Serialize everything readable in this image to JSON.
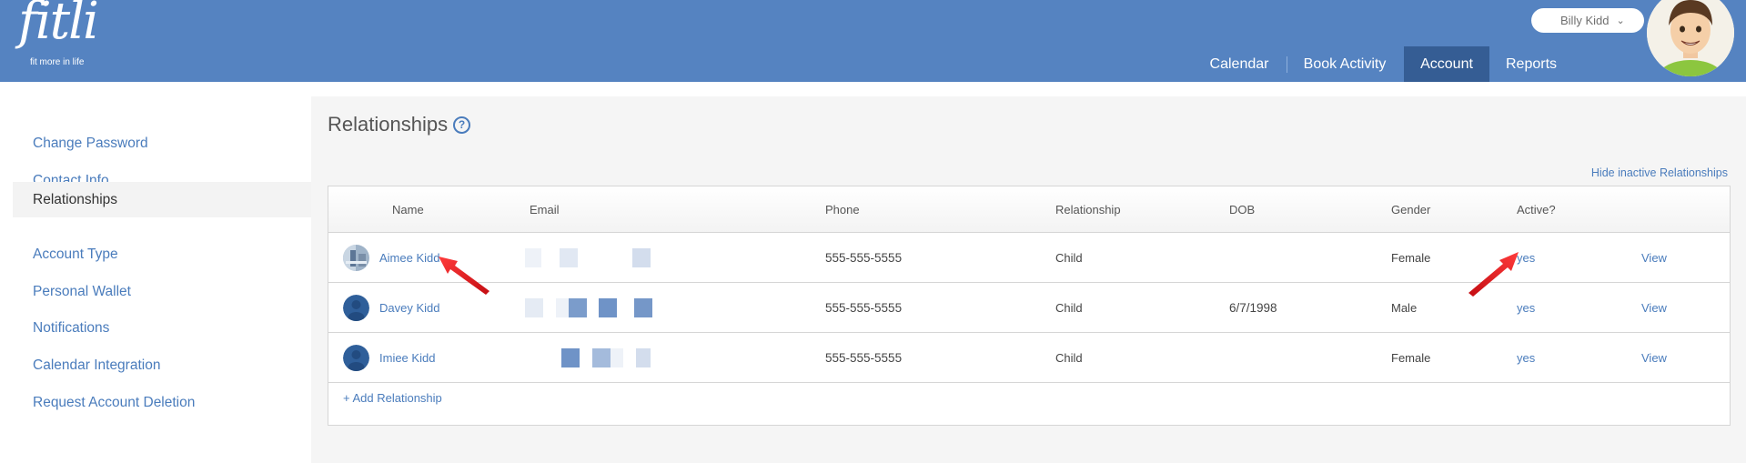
{
  "brand": {
    "logo_text": "fitli",
    "tagline": "fit more in life"
  },
  "user_menu": {
    "name": "Billy Kidd",
    "chevron": "⌄"
  },
  "nav": {
    "items": [
      {
        "label": "Calendar"
      },
      {
        "label": "Book Activity"
      },
      {
        "label": "Account",
        "active": true
      },
      {
        "label": "Reports"
      }
    ]
  },
  "sidebar": {
    "items": [
      {
        "label": "Change Password"
      },
      {
        "label": "Contact Info"
      },
      {
        "label": "Relationships",
        "active": true
      },
      {
        "label": "Account Type"
      },
      {
        "label": "Personal Wallet"
      },
      {
        "label": "Notifications"
      },
      {
        "label": "Calendar Integration"
      },
      {
        "label": "Request Account Deletion"
      }
    ]
  },
  "page": {
    "title": "Relationships",
    "help_icon": "?",
    "hide_inactive_label": "Hide inactive Relationships",
    "add_label": "+ Add Relationship"
  },
  "table": {
    "columns": [
      "Name",
      "Email",
      "Phone",
      "Relationship",
      "DOB",
      "Gender",
      "Active?",
      ""
    ],
    "rows": [
      {
        "name": "Aimee Kidd",
        "email": "",
        "phone": "555-555-5555",
        "relationship": "Child",
        "dob": "",
        "gender": "Female",
        "active": "yes",
        "action": "View"
      },
      {
        "name": "Davey Kidd",
        "email": "",
        "phone": "555-555-5555",
        "relationship": "Child",
        "dob": "6/7/1998",
        "gender": "Male",
        "active": "yes",
        "action": "View"
      },
      {
        "name": "Imiee Kidd",
        "email": "",
        "phone": "555-555-5555",
        "relationship": "Child",
        "dob": "",
        "gender": "Female",
        "active": "yes",
        "action": "View"
      }
    ]
  },
  "colors": {
    "header": "#5583c1",
    "nav_active": "#355d94",
    "link": "#4a7cbc",
    "annotation_arrow": "#e8141b"
  },
  "icons": [
    "help-icon",
    "user-avatar-icon",
    "chevron-down-icon",
    "annotation-arrow-icon"
  ]
}
